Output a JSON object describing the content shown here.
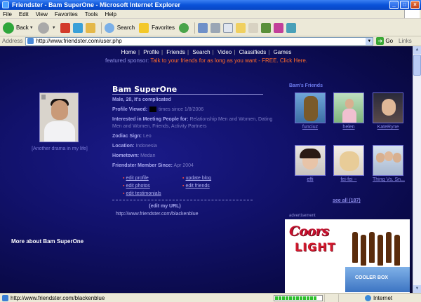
{
  "window": {
    "title": "Friendster - Bam SuperOne - Microsoft Internet Explorer"
  },
  "menu": [
    "File",
    "Edit",
    "View",
    "Favorites",
    "Tools",
    "Help"
  ],
  "toolbar": {
    "back": "Back",
    "search": "Search",
    "favorites": "Favorites"
  },
  "address": {
    "label": "Address",
    "url": "http://www.friendster.com/user.php",
    "go": "Go",
    "links": "Links"
  },
  "nav": [
    "Home",
    "Profile",
    "Friends",
    "Search",
    "Video",
    "Classifieds",
    "Games"
  ],
  "sponsor": {
    "prefix": "featured sponsor:",
    "text": "Talk to your friends for as long as you want - FREE. Click Here."
  },
  "profile": {
    "name": "Bam SuperOne",
    "caption": "[Another drama in my life]",
    "summary": "Male, 20, It's complicated",
    "viewed_label": "Profile Viewed:",
    "viewed_text": "times since 1/8/2006",
    "interested_label": "Interested in Meeting People for:",
    "interested_value": "Relationship Men and Women, Dating Men and Women, Friends, Activity Partners",
    "zodiac_label": "Zodiac Sign:",
    "zodiac_value": "Leo",
    "location_label": "Location:",
    "location_value": "Indonesia",
    "hometown_label": "Hometown:",
    "hometown_value": "Medan",
    "member_label": "Friendster Member Since:",
    "member_value": "Apr 2004",
    "edit_links": [
      "edit profile",
      "update blog",
      "edit photos",
      "edit friends",
      "edit testimonials"
    ],
    "edit_url_label": "(edit my URL)",
    "profile_url": "http://www.friendster.com/blackenblue",
    "more_about": "More about Bam SuperOne"
  },
  "friends": {
    "title": "Bam's Friends",
    "items": [
      {
        "name": "funciuz"
      },
      {
        "name": "helen"
      },
      {
        "name": "KateRyne"
      },
      {
        "name": "effi"
      },
      {
        "name": "fei-fei ~"
      },
      {
        "name": "Thing Vs. Sn..."
      }
    ],
    "see_all": "see all (187)"
  },
  "ad": {
    "label": "advertisement",
    "brand": "Coors",
    "sub": "LIGHT",
    "crate": "COOLER BOX"
  },
  "status": {
    "text": "http://www.friendster.com/blackenblue",
    "zone": "Internet"
  },
  "colors": {
    "page_bg": "#11116a",
    "accent_link": "#8a8ae8",
    "sponsor": "#ff6a2a",
    "title_bar": "#0a53d9"
  }
}
